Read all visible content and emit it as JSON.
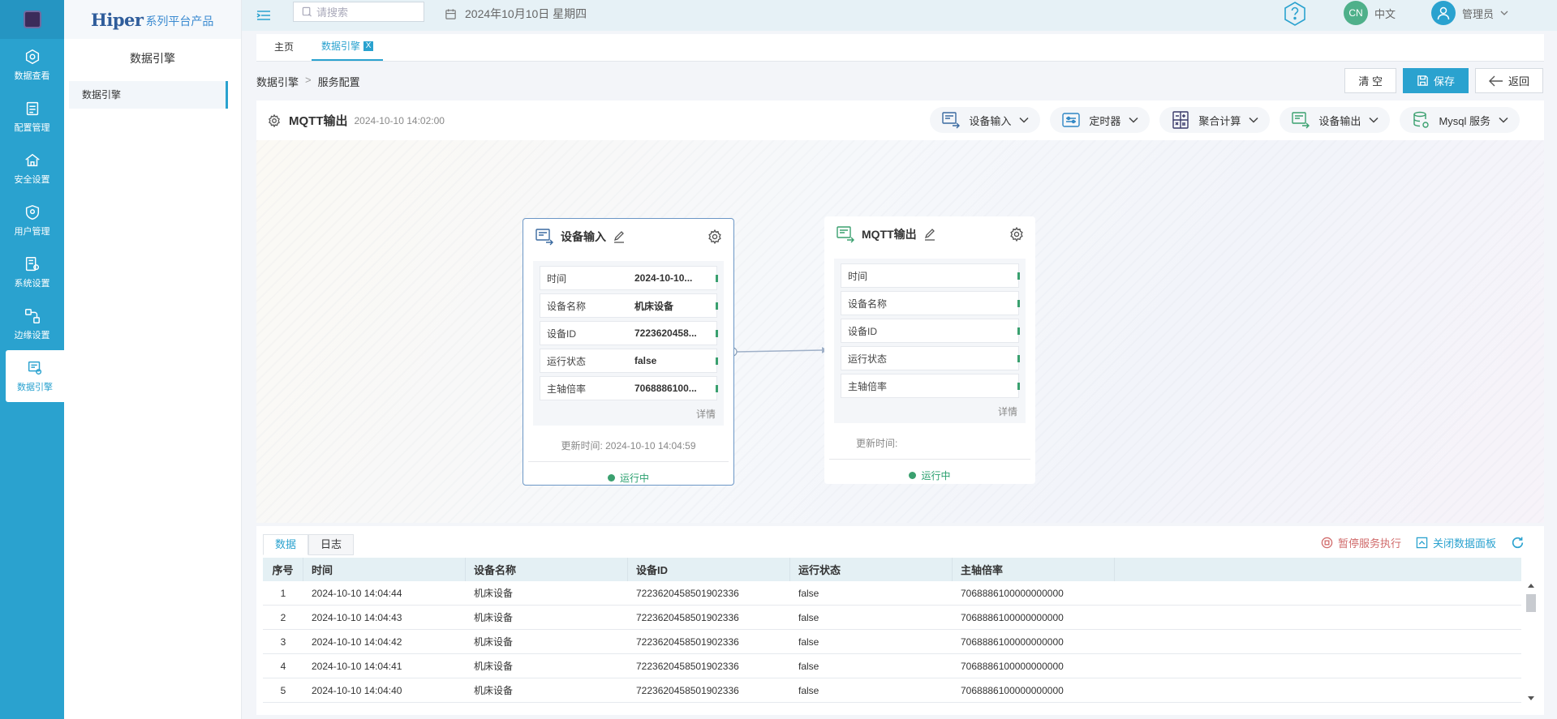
{
  "brand": {
    "name": "Hiper",
    "suffix": "系列平台产品"
  },
  "rail": [
    {
      "label": "数据查看",
      "icon": "data-view-icon"
    },
    {
      "label": "配置管理",
      "icon": "config-icon"
    },
    {
      "label": "安全设置",
      "icon": "security-icon"
    },
    {
      "label": "用户管理",
      "icon": "user-shield-icon"
    },
    {
      "label": "系统设置",
      "icon": "system-icon"
    },
    {
      "label": "边缘设置",
      "icon": "edge-icon"
    },
    {
      "label": "数据引擎",
      "icon": "data-engine-icon"
    }
  ],
  "sidebar": {
    "title": "数据引擎",
    "items": [
      {
        "label": "数据引擎"
      }
    ]
  },
  "topbar": {
    "search_placeholder": "请搜索",
    "date": "2024年10月10日 星期四",
    "lang_badge": "CN",
    "lang_label": "中文",
    "user": "管理员"
  },
  "tabs": [
    {
      "label": "主页"
    },
    {
      "label": "数据引擎",
      "close": "X"
    }
  ],
  "breadcrumb": {
    "root": "数据引擎",
    "sep": ">",
    "current": "服务配置"
  },
  "actions": {
    "clear": "清 空",
    "save": "保存",
    "back": "返回"
  },
  "flow": {
    "title": "MQTT输出",
    "time": "2024-10-10 14:02:00",
    "tools": [
      {
        "label": "设备输入"
      },
      {
        "label": "定时器"
      },
      {
        "label": "聚合计算"
      },
      {
        "label": "设备输出"
      },
      {
        "label": "Mysql 服务"
      }
    ]
  },
  "nodes": {
    "input": {
      "title": "设备输入",
      "fields": [
        {
          "k": "时间",
          "v": "2024-10-10..."
        },
        {
          "k": "设备名称",
          "v": "机床设备"
        },
        {
          "k": "设备ID",
          "v": "7223620458..."
        },
        {
          "k": "运行状态",
          "v": "false"
        },
        {
          "k": "主轴倍率",
          "v": "7068886100..."
        }
      ],
      "detail": "详情",
      "updated": "更新时间: 2024-10-10 14:04:59",
      "status": "运行中"
    },
    "output": {
      "title": "MQTT输出",
      "fields": [
        {
          "k": "时间",
          "v": ""
        },
        {
          "k": "设备名称",
          "v": ""
        },
        {
          "k": "设备ID",
          "v": ""
        },
        {
          "k": "运行状态",
          "v": ""
        },
        {
          "k": "主轴倍率",
          "v": ""
        }
      ],
      "detail": "详情",
      "updated": "更新时间:",
      "status": "运行中"
    }
  },
  "panel": {
    "tabs": [
      {
        "label": "数据"
      },
      {
        "label": "日志"
      }
    ],
    "pause": "暂停服务执行",
    "close": "关闭数据面板",
    "columns": [
      "序号",
      "时间",
      "设备名称",
      "设备ID",
      "运行状态",
      "主轴倍率"
    ],
    "rows": [
      [
        "1",
        "2024-10-10 14:04:44",
        "机床设备",
        "7223620458501902336",
        "false",
        "7068886100000000000"
      ],
      [
        "2",
        "2024-10-10 14:04:43",
        "机床设备",
        "7223620458501902336",
        "false",
        "7068886100000000000"
      ],
      [
        "3",
        "2024-10-10 14:04:42",
        "机床设备",
        "7223620458501902336",
        "false",
        "7068886100000000000"
      ],
      [
        "4",
        "2024-10-10 14:04:41",
        "机床设备",
        "7223620458501902336",
        "false",
        "7068886100000000000"
      ],
      [
        "5",
        "2024-10-10 14:04:40",
        "机床设备",
        "7223620458501902336",
        "false",
        "7068886100000000000"
      ]
    ]
  },
  "colors": {
    "accent": "#2aa2cf",
    "running": "#3aa06f",
    "danger": "#d06a6a"
  }
}
